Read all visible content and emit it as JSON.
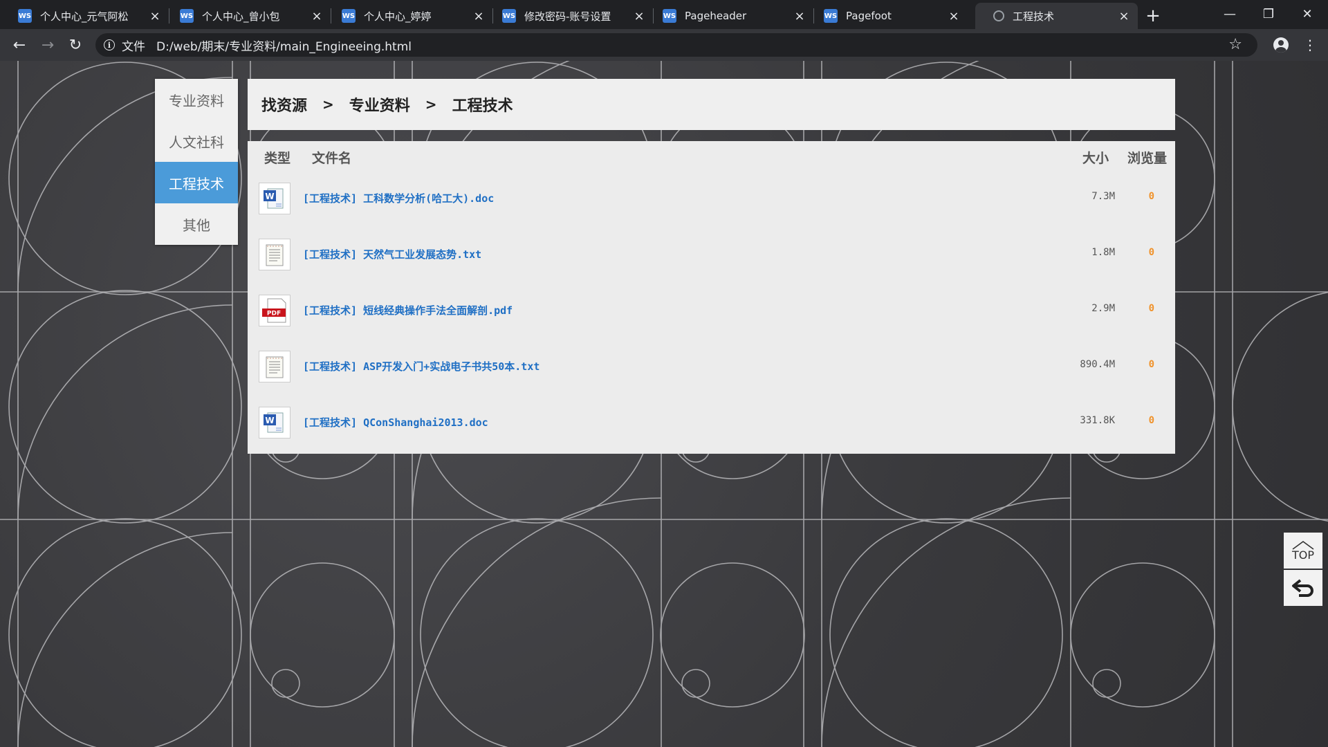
{
  "browser": {
    "tabs": [
      {
        "title": "个人中心_元气阿松",
        "favicon": "ws-icon"
      },
      {
        "title": "个人中心_曾小包",
        "favicon": "ws-icon"
      },
      {
        "title": "个人中心_婷婷",
        "favicon": "ws-icon"
      },
      {
        "title": "修改密码-账号设置",
        "favicon": "ws-icon"
      },
      {
        "title": "Pageheader",
        "favicon": "ws-icon"
      },
      {
        "title": "Pagefoot",
        "favicon": "ws-icon"
      },
      {
        "title": "工程技术",
        "favicon": "globe-icon",
        "active": true
      }
    ],
    "favicon_text": "WS",
    "scheme_label": "文件",
    "url": "D:/web/期末/专业资料/main_Engineeing.html"
  },
  "sidebar": {
    "items": [
      {
        "label": "专业资料"
      },
      {
        "label": "人文社科"
      },
      {
        "label": "工程技术",
        "active": true
      },
      {
        "label": "其他"
      }
    ]
  },
  "breadcrumb": {
    "items": [
      "找资源",
      "专业资料",
      "工程技术"
    ],
    "separator": ">"
  },
  "file_table": {
    "headers": {
      "type": "类型",
      "name": "文件名",
      "size": "大小",
      "views": "浏览量"
    },
    "rows": [
      {
        "icon": "word-doc-icon",
        "name": "[工程技术] 工科数学分析(哈工大).doc",
        "size": "7.3M",
        "views": "0"
      },
      {
        "icon": "txt-file-icon",
        "name": "[工程技术] 天然气工业发展态势.txt",
        "size": "1.8M",
        "views": "0"
      },
      {
        "icon": "pdf-file-icon",
        "name": "[工程技术] 短线经典操作手法全面解剖.pdf",
        "size": "2.9M",
        "views": "0"
      },
      {
        "icon": "txt-file-icon",
        "name": "[工程技术] ASP开发入门+实战电子书共50本.txt",
        "size": "890.4M",
        "views": "0"
      },
      {
        "icon": "word-doc-icon",
        "name": "[工程技术] QConShanghai2013.doc",
        "size": "331.8K",
        "views": "0"
      }
    ],
    "pdf_badge": "PDF"
  },
  "floating": {
    "top_label": "TOP"
  },
  "colors": {
    "accent": "#4b9bd9",
    "link": "#1f6fc4",
    "views": "#f0922a"
  }
}
